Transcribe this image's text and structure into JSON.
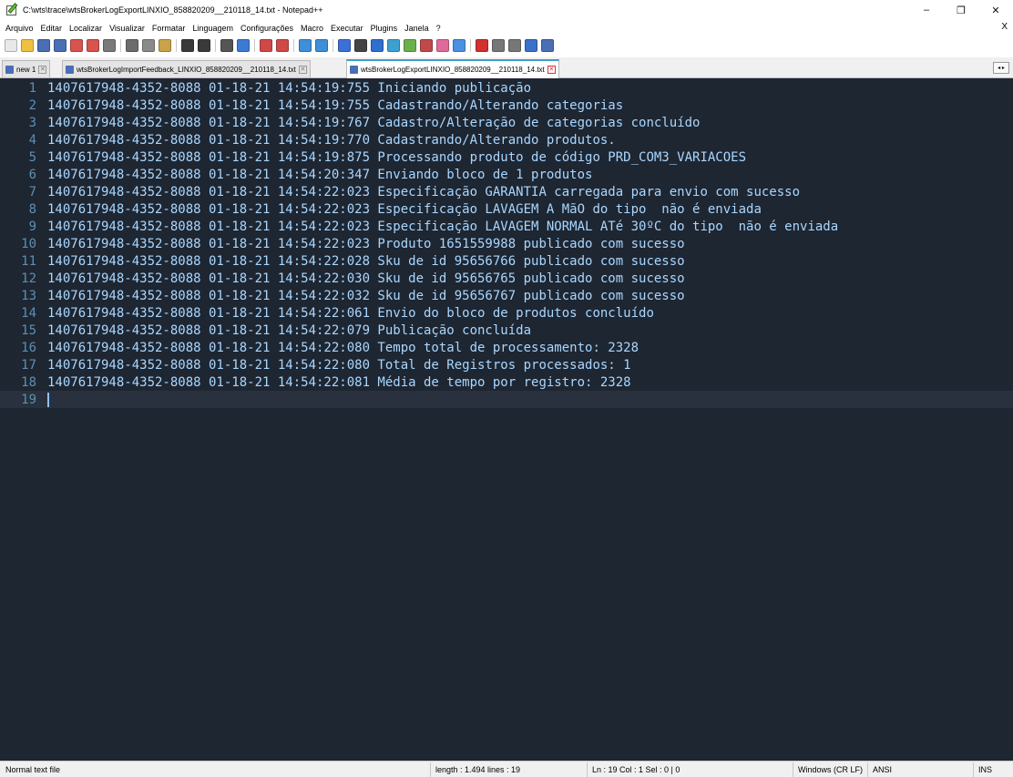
{
  "window": {
    "title": "C:\\wts\\trace\\wtsBrokerLogExportLINXIO_858820209__210118_14.txt - Notepad++",
    "minimize": "–",
    "restore": "❐",
    "close": "✕"
  },
  "menu": {
    "items": [
      "Arquivo",
      "Editar",
      "Localizar",
      "Visualizar",
      "Formatar",
      "Linguagem",
      "Configurações",
      "Macro",
      "Executar",
      "Plugins",
      "Janela",
      "?"
    ],
    "close": "X"
  },
  "toolbar": {
    "icons": [
      {
        "name": "new-file-icon",
        "color": "#e8e8e8"
      },
      {
        "name": "open-file-icon",
        "color": "#f0c040"
      },
      {
        "name": "save-icon",
        "color": "#4a6fb5"
      },
      {
        "name": "save-all-icon",
        "color": "#4a6fb5"
      },
      {
        "name": "close-icon",
        "color": "#d9534f"
      },
      {
        "name": "close-all-icon",
        "color": "#d9534f"
      },
      {
        "name": "print-icon",
        "color": "#7a7a7a"
      },
      {
        "sep": true
      },
      {
        "name": "cut-icon",
        "color": "#6c6c6c"
      },
      {
        "name": "copy-icon",
        "color": "#8a8a8a"
      },
      {
        "name": "paste-icon",
        "color": "#c9a24a"
      },
      {
        "sep": true
      },
      {
        "name": "undo-icon",
        "color": "#3a3a3a"
      },
      {
        "name": "redo-icon",
        "color": "#3a3a3a"
      },
      {
        "sep": true
      },
      {
        "name": "find-icon",
        "color": "#555555"
      },
      {
        "name": "replace-icon",
        "color": "#3b7bd4"
      },
      {
        "sep": true
      },
      {
        "name": "zoom-in-icon",
        "color": "#d04848"
      },
      {
        "name": "zoom-out-icon",
        "color": "#d04848"
      },
      {
        "sep": true
      },
      {
        "name": "sync-vertical-icon",
        "color": "#3d8fd8"
      },
      {
        "name": "sync-horizontal-icon",
        "color": "#3d8fd8"
      },
      {
        "sep": true
      },
      {
        "name": "word-wrap-icon",
        "color": "#3d6fd8"
      },
      {
        "name": "show-all-chars-icon",
        "color": "#444444"
      },
      {
        "name": "indent-guide-icon",
        "color": "#2f6fd0"
      },
      {
        "name": "document-map-icon",
        "color": "#3ca0d0"
      },
      {
        "name": "function-list-icon",
        "color": "#6ab04c"
      },
      {
        "name": "doc-list-icon",
        "color": "#c04a4a"
      },
      {
        "name": "folder-workspace-icon",
        "color": "#e06a9a"
      },
      {
        "name": "monitoring-icon",
        "color": "#4a90e2"
      },
      {
        "sep": true
      },
      {
        "name": "record-macro-icon",
        "color": "#d33030"
      },
      {
        "name": "stop-macro-icon",
        "color": "#777777"
      },
      {
        "name": "play-macro-icon",
        "color": "#777777"
      },
      {
        "name": "run-macro-multiple-icon",
        "color": "#3a70c8"
      },
      {
        "name": "save-macro-icon",
        "color": "#4a6fb5"
      }
    ]
  },
  "tabs": [
    {
      "label": "new 1",
      "active": false
    },
    {
      "label": "wtsBrokerLogImportFeedback_LINXIO_858820209__210118_14.txt",
      "active": false
    },
    {
      "label": "wtsBrokerLogExportLINXIO_858820209__210118_14.txt",
      "active": true
    }
  ],
  "tab_scroll": "◂ ▸",
  "editor": {
    "lines": [
      {
        "n": "1",
        "text": "1407617948-4352-8088 01-18-21 14:54:19:755 Iniciando publicação"
      },
      {
        "n": "2",
        "text": "1407617948-4352-8088 01-18-21 14:54:19:755 Cadastrando/Alterando categorias"
      },
      {
        "n": "3",
        "text": "1407617948-4352-8088 01-18-21 14:54:19:767 Cadastro/Alteração de categorias concluído"
      },
      {
        "n": "4",
        "text": "1407617948-4352-8088 01-18-21 14:54:19:770 Cadastrando/Alterando produtos."
      },
      {
        "n": "5",
        "text": "1407617948-4352-8088 01-18-21 14:54:19:875 Processando produto de código PRD_COM3_VARIACOES"
      },
      {
        "n": "6",
        "text": "1407617948-4352-8088 01-18-21 14:54:20:347 Enviando bloco de 1 produtos"
      },
      {
        "n": "7",
        "text": "1407617948-4352-8088 01-18-21 14:54:22:023 Especificação GARANTIA carregada para envio com sucesso"
      },
      {
        "n": "8",
        "text": "1407617948-4352-8088 01-18-21 14:54:22:023 Especificação LAVAGEM A MãO do tipo  não é enviada"
      },
      {
        "n": "9",
        "text": "1407617948-4352-8088 01-18-21 14:54:22:023 Especificação LAVAGEM NORMAL ATé 30ºC do tipo  não é enviada"
      },
      {
        "n": "10",
        "text": "1407617948-4352-8088 01-18-21 14:54:22:023 Produto 1651559988 publicado com sucesso"
      },
      {
        "n": "11",
        "text": "1407617948-4352-8088 01-18-21 14:54:22:028 Sku de id 95656766 publicado com sucesso"
      },
      {
        "n": "12",
        "text": "1407617948-4352-8088 01-18-21 14:54:22:030 Sku de id 95656765 publicado com sucesso"
      },
      {
        "n": "13",
        "text": "1407617948-4352-8088 01-18-21 14:54:22:032 Sku de id 95656767 publicado com sucesso"
      },
      {
        "n": "14",
        "text": "1407617948-4352-8088 01-18-21 14:54:22:061 Envio do bloco de produtos concluído"
      },
      {
        "n": "15",
        "text": "1407617948-4352-8088 01-18-21 14:54:22:079 Publicação concluída"
      },
      {
        "n": "16",
        "text": "1407617948-4352-8088 01-18-21 14:54:22:080 Tempo total de processamento: 2328"
      },
      {
        "n": "17",
        "text": "1407617948-4352-8088 01-18-21 14:54:22:080 Total de Registros processados: 1"
      },
      {
        "n": "18",
        "text": "1407617948-4352-8088 01-18-21 14:54:22:081 Média de tempo por registro: 2328"
      },
      {
        "n": "19",
        "text": ""
      }
    ],
    "current_line": "19",
    "colors": {
      "background": "#1e2632",
      "text": "#a9d7ff",
      "line_number": "#5d8fb3",
      "current_line": "#28313d"
    }
  },
  "status": {
    "file_type": "Normal text file",
    "length_lines": "length : 1.494    lines : 19",
    "position": "Ln : 19    Col : 1    Sel : 0 | 0",
    "eol": "Windows (CR LF)",
    "encoding": "ANSI",
    "mode": "INS"
  }
}
